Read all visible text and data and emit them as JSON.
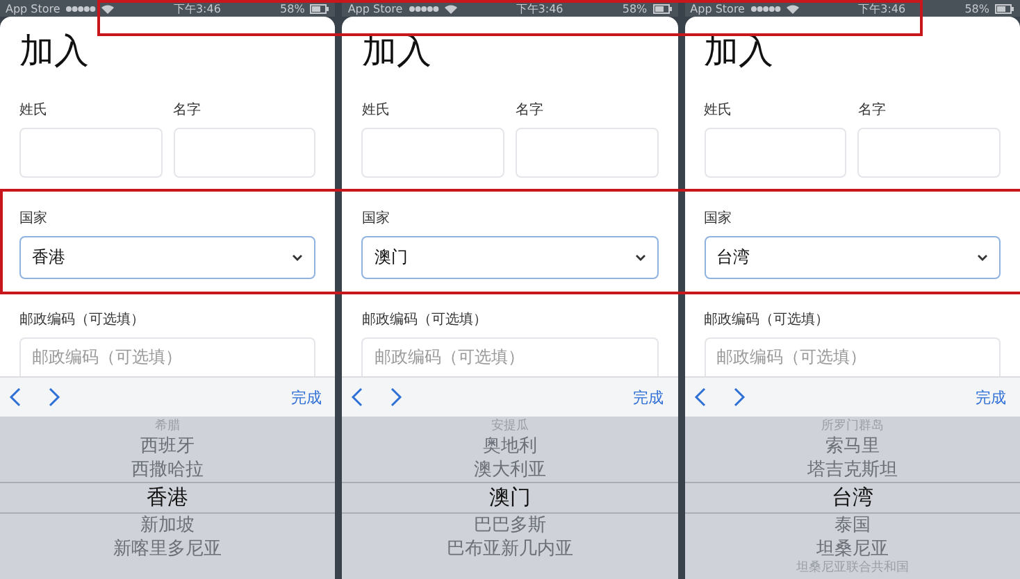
{
  "panels": [
    {
      "status_bar": {
        "carrier": "App Store",
        "time": "下午3:46",
        "battery": "58%"
      },
      "title": "加入",
      "last_name_label": "姓氏",
      "first_name_label": "名字",
      "country_label": "国家",
      "country_value": "香港",
      "postal_label": "邮政编码（可选填）",
      "postal_placeholder": "邮政编码（可选填）",
      "toolbar": {
        "done": "完成"
      },
      "picker": [
        {
          "label": "希腊",
          "selected": false
        },
        {
          "label": "西班牙",
          "selected": false
        },
        {
          "label": "西撒哈拉",
          "selected": false
        },
        {
          "label": "香港",
          "selected": true
        },
        {
          "label": "新加坡",
          "selected": false
        },
        {
          "label": "新喀里多尼亚",
          "selected": false
        }
      ]
    },
    {
      "status_bar": {
        "carrier": "App Store",
        "time": "下午3:46",
        "battery": "58%"
      },
      "title": "加入",
      "last_name_label": "姓氏",
      "first_name_label": "名字",
      "country_label": "国家",
      "country_value": "澳门",
      "postal_label": "邮政编码（可选填）",
      "postal_placeholder": "邮政编码（可选填）",
      "toolbar": {
        "done": "完成"
      },
      "picker": [
        {
          "label": "安提瓜",
          "selected": false
        },
        {
          "label": "奥地利",
          "selected": false
        },
        {
          "label": "澳大利亚",
          "selected": false
        },
        {
          "label": "澳门",
          "selected": true
        },
        {
          "label": "巴巴多斯",
          "selected": false
        },
        {
          "label": "巴布亚新几内亚",
          "selected": false
        }
      ]
    },
    {
      "status_bar": {
        "carrier": "App Store",
        "time": "下午3:46",
        "battery": "58%"
      },
      "title": "加入",
      "last_name_label": "姓氏",
      "first_name_label": "名字",
      "country_label": "国家",
      "country_value": "台湾",
      "postal_label": "邮政编码（可选填）",
      "postal_placeholder": "邮政编码（可选填）",
      "toolbar": {
        "done": "完成"
      },
      "picker": [
        {
          "label": "所罗门群岛",
          "selected": false
        },
        {
          "label": "索马里",
          "selected": false
        },
        {
          "label": "塔吉克斯坦",
          "selected": false
        },
        {
          "label": "台湾",
          "selected": true
        },
        {
          "label": "泰国",
          "selected": false
        },
        {
          "label": "坦桑尼亚",
          "selected": false
        },
        {
          "label": "坦桑尼亚联合共和国",
          "selected": false
        }
      ]
    }
  ]
}
